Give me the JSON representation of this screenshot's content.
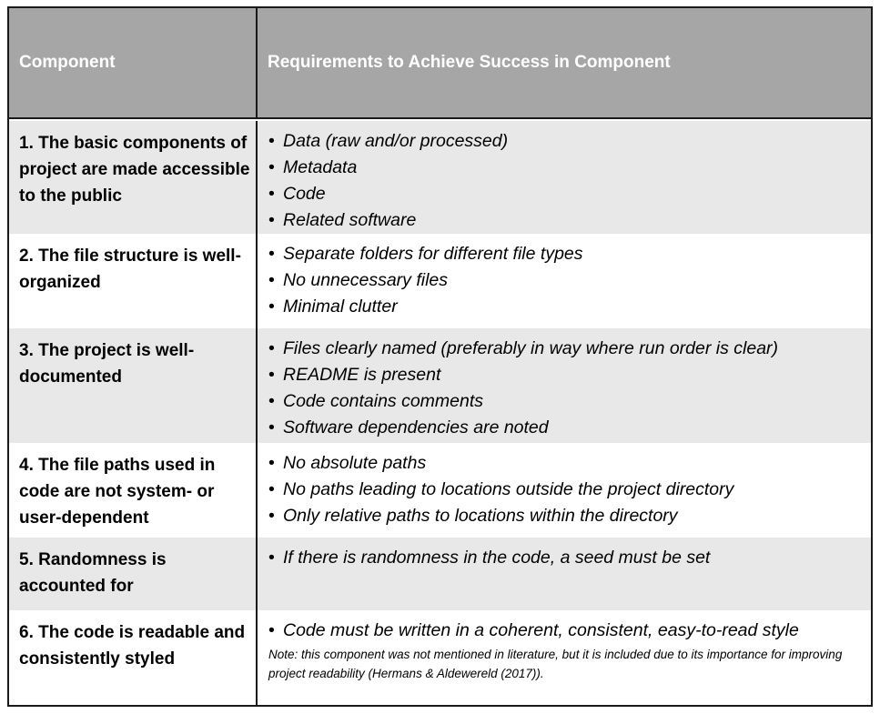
{
  "header": {
    "component": "Component",
    "requirements": "Requirements to Achieve Success in Component"
  },
  "rows": [
    {
      "component": "1. The basic  components of project are made accessible to the public",
      "requirements": [
        "Data (raw and/or processed)",
        "Metadata",
        "Code",
        "Related software"
      ]
    },
    {
      "component": "2. The file structure is well-organized",
      "requirements": [
        "Separate folders for different file types",
        "No unnecessary files",
        "Minimal clutter"
      ]
    },
    {
      "component": "3. The project is well-documented",
      "requirements": [
        "Files clearly named (preferably in way where run order is clear)",
        "README is present",
        "Code contains comments",
        "Software dependencies are noted"
      ]
    },
    {
      "component": "4. The file paths used in code are not system- or user-dependent",
      "requirements": [
        "No absolute paths",
        "No paths leading to locations outside the project directory",
        "Only relative paths to locations within the directory"
      ]
    },
    {
      "component": "5. Randomness is accounted for",
      "requirements": [
        "If there is randomness in the code, a seed must be set"
      ]
    },
    {
      "component": "6. The code is readable and consistently styled",
      "requirements": [
        "Code must be written in a coherent, consistent, easy-to-read style"
      ],
      "note": "Note: this component was not mentioned in literature, but it is included due to its importance for improving project readability (Hermans & Aldewereld (2017))."
    }
  ]
}
